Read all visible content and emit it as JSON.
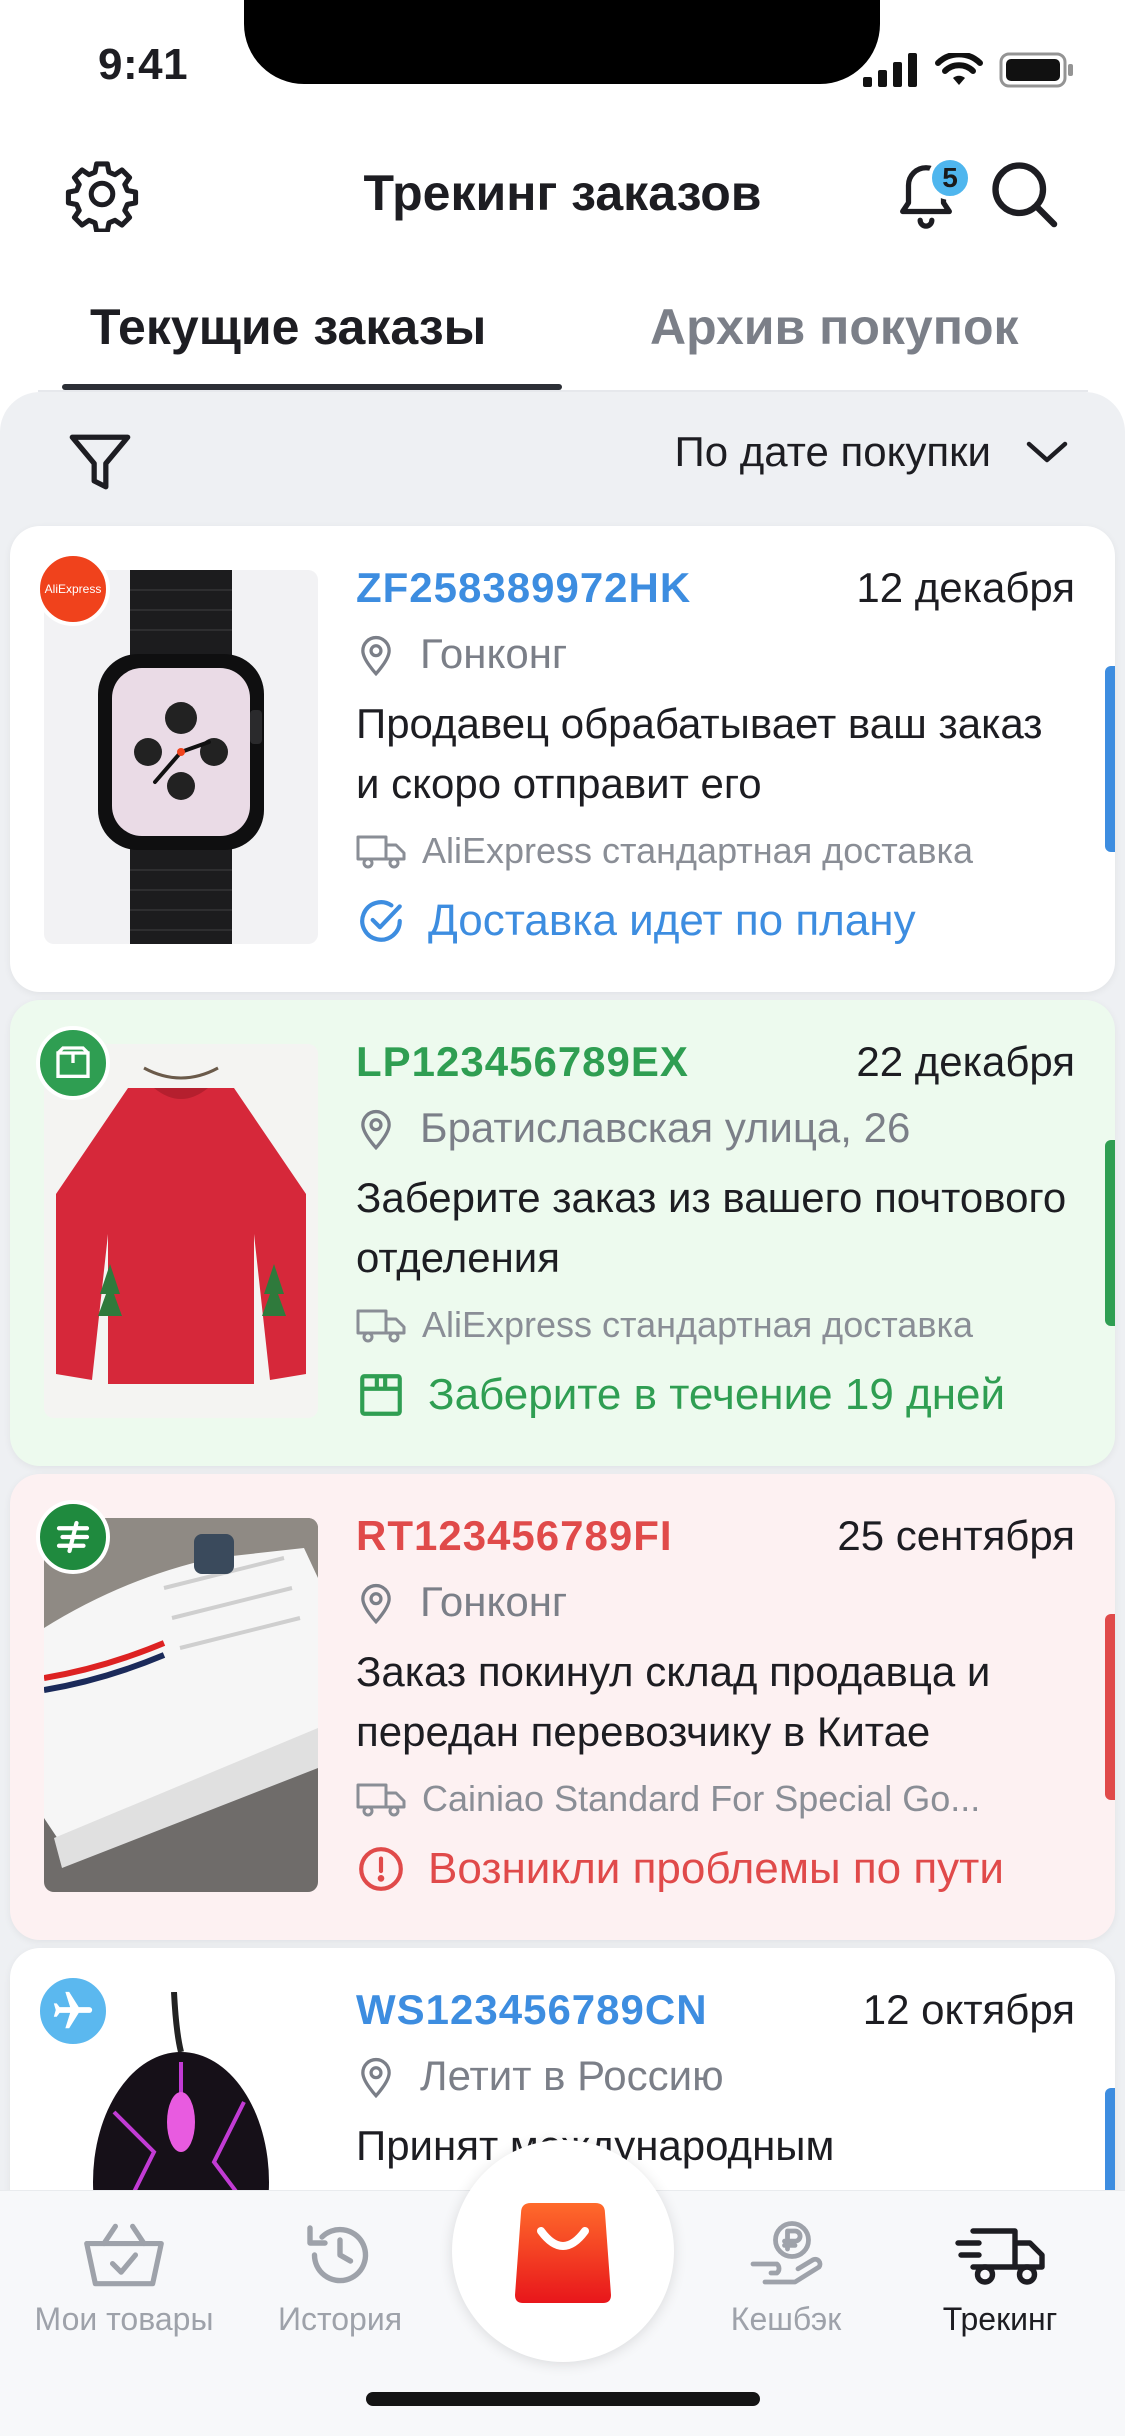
{
  "status_bar": {
    "time": "9:41"
  },
  "header": {
    "title": "Трекинг заказов",
    "notifications_count": "5"
  },
  "tabs": [
    {
      "label": "Текущие заказы",
      "active": true
    },
    {
      "label": "Архив покупок",
      "active": false
    }
  ],
  "sort": {
    "label": "По дате покупки"
  },
  "orders": [
    {
      "tracking": "ZF258389972HK",
      "date": "12 декабря",
      "location": "Гонконг",
      "description": "Продавец обрабатывает ваш заказ и скоро отправит его",
      "shipping": "AliExpress стандартная доставка",
      "status": "Доставка идет по плану",
      "accent": "#3d8de0",
      "carrier_badge_text": "AliExpress"
    },
    {
      "tracking": "LP123456789EX",
      "date": "22 декабря",
      "location": "Братиславская улица, 26",
      "description": "Заберите заказ из вашего почтового отделения",
      "shipping": "AliExpress стандартная доставка",
      "status": "Заберите в течение 19 дней",
      "accent": "#2f9e52"
    },
    {
      "tracking": "RT123456789FI",
      "date": "25 сентября",
      "location": "Гонконг",
      "description": "Заказ покинул склад продавца и передан перевозчику в Китае",
      "shipping": "Cainiao Standard For Special Go...",
      "status": "Возникли проблемы по пути",
      "accent": "#e04a4a"
    },
    {
      "tracking": "WS123456789CN",
      "date": "12 октября",
      "location": "Летит в Россию",
      "description": "Принят международным",
      "accent": "#3d8de0"
    }
  ],
  "bottom_nav": [
    {
      "label": "Мои товары",
      "icon": "basket-icon"
    },
    {
      "label": "История",
      "icon": "history-icon"
    },
    {
      "label": "Кешбэк",
      "icon": "cashback-icon"
    },
    {
      "label": "Трекинг",
      "icon": "truck-icon",
      "active": true
    }
  ]
}
